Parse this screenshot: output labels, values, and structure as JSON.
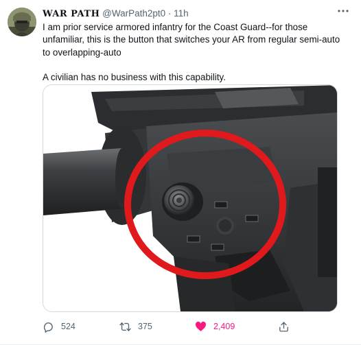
{
  "tweet": {
    "author": {
      "display_name": "WAR PATH",
      "handle": "@WarPath2pt0",
      "separator": "·",
      "time": "11h"
    },
    "text": [
      "I am prior service armored infantry for the Coast Guard--for those unfamiliar, this is the button that switches your AR from regular semi-auto to overlapping-auto",
      "A civilian has no business with this capability."
    ],
    "stats": {
      "replies": "524",
      "retweets": "375",
      "likes": "2,409"
    },
    "icons": {
      "more": "more-icon",
      "reply": "reply-icon",
      "retweet": "retweet-icon",
      "like": "heart-icon",
      "share": "share-icon"
    },
    "liked": true
  },
  "colors": {
    "like_active": "#f91880",
    "secondary_text": "#536471",
    "circle_highlight": "#e0191c"
  }
}
